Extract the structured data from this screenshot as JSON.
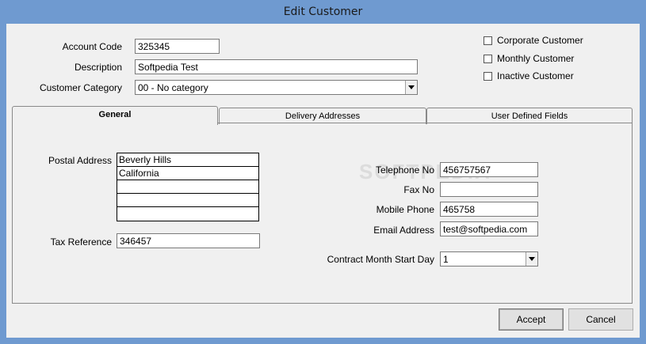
{
  "window": {
    "title": "Edit Customer"
  },
  "header": {
    "account_code_label": "Account Code",
    "account_code_value": "325345",
    "description_label": "Description",
    "description_value": "Softpedia Test",
    "category_label": "Customer Category",
    "category_value": "00 - No category"
  },
  "checkboxes": {
    "corporate": "Corporate Customer",
    "monthly": "Monthly Customer",
    "inactive": "Inactive Customer"
  },
  "tabs": [
    {
      "label": "General",
      "active": true
    },
    {
      "label": "Delivery Addresses",
      "active": false
    },
    {
      "label": "User Defined Fields",
      "active": false
    }
  ],
  "general": {
    "postal_label": "Postal Address",
    "postal_lines": [
      "Beverly Hills",
      "California",
      "",
      "",
      ""
    ],
    "tax_label": "Tax Reference",
    "tax_value": "346457",
    "telephone_label": "Telephone No",
    "telephone_value": "456757567",
    "fax_label": "Fax No",
    "fax_value": "",
    "mobile_label": "Mobile Phone",
    "mobile_value": "465758",
    "email_label": "Email Address",
    "email_value": "test@softpedia.com",
    "contract_label": "Contract Month Start Day",
    "contract_value": "1"
  },
  "buttons": {
    "accept": "Accept",
    "cancel": "Cancel"
  },
  "watermark": "SOFTPEDIA"
}
